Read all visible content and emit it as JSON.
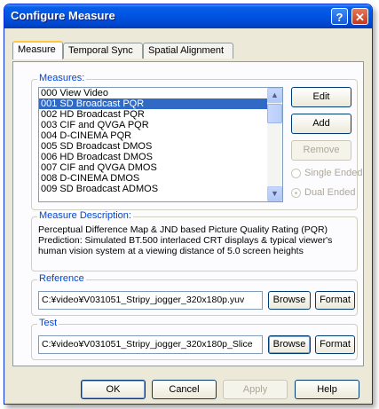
{
  "window": {
    "title": "Configure Measure",
    "help_icon": "question-icon",
    "close_icon": "close-icon"
  },
  "tabs": [
    {
      "label": "Measure",
      "active": true
    },
    {
      "label": "Temporal Sync",
      "active": false
    },
    {
      "label": "Spatial Alignment",
      "active": false
    }
  ],
  "measures": {
    "label": "Measures:",
    "items": [
      "000 View Video",
      "001 SD Broadcast PQR",
      "002 HD Broadcast PQR",
      "003 CIF and QVGA PQR",
      "004 D-CINEMA PQR",
      "005 SD Broadcast DMOS",
      "006 HD Broadcast DMOS",
      "007 CIF and QVGA DMOS",
      "008 D-CINEMA DMOS",
      "009 SD Broadcast ADMOS"
    ],
    "selected_index": 1,
    "edit_label": "Edit",
    "add_label": "Add",
    "remove_label": "Remove",
    "single_ended_label": "Single Ended",
    "dual_ended_label": "Dual Ended",
    "dual_ended_checked": true
  },
  "description": {
    "label": "Measure Description:",
    "text": "Perceptual Difference Map & JND based Picture Quality Rating  (PQR)\nPrediction:  Simulated BT.500 interlaced CRT displays & typical viewer's human vision system at a viewing distance of 5.0 screen heights"
  },
  "reference": {
    "label": "Reference",
    "path": "C:¥video¥V031051_Stripy_jogger_320x180p.yuv",
    "browse_label": "Browse",
    "format_label": "Format"
  },
  "test": {
    "label": "Test",
    "path": "C:¥video¥V031051_Stripy_jogger_320x180p_Slice",
    "browse_label": "Browse",
    "format_label": "Format"
  },
  "footer": {
    "ok_label": "OK",
    "cancel_label": "Cancel",
    "apply_label": "Apply",
    "help_label": "Help"
  }
}
